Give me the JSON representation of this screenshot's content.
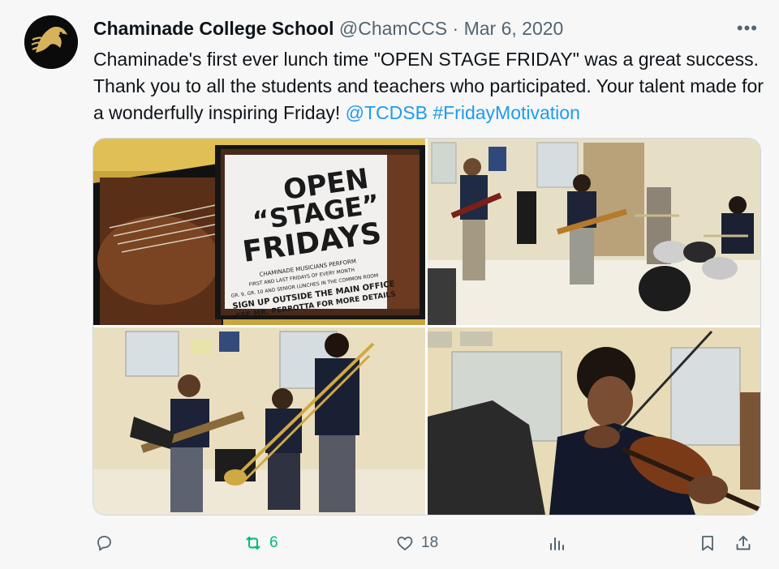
{
  "tweet": {
    "author_name": "Chaminade College School",
    "handle": "@ChamCCS",
    "separator": "·",
    "date": "Mar 6, 2020",
    "more": "•••",
    "text_main": "Chaminade's first ever lunch time \"OPEN STAGE FRIDAY\" was a great success. Thank you to all the students and teachers who participated. Your talent made for a wonderfully inspiring Friday! ",
    "mention": "@TCDSB",
    "hashtag": "#FridayMotivation"
  },
  "poster": {
    "line1": "OPEN",
    "line2": "“STAGE”",
    "line3": "FRIDAYS",
    "sub1": "CHAMINADE MUSICIANS PERFORM",
    "sub2": "FIRST AND LAST FRIDAYS OF EVERY MONTH",
    "sub3": "GR. 9, GR. 10 AND SENIOR LUNCHES IN THE COMMON ROOM",
    "sub4": "SIGN UP OUTSIDE THE MAIN OFFICE",
    "sub5": "SEE MR. PERROTTA FOR MORE DETAILS"
  },
  "actions": {
    "reply_count": "",
    "retweet_count": "6",
    "like_count": "18",
    "views_count": ""
  },
  "colors": {
    "link": "#1d9bf0",
    "retweet": "#00ba7c",
    "muted": "#536471"
  }
}
